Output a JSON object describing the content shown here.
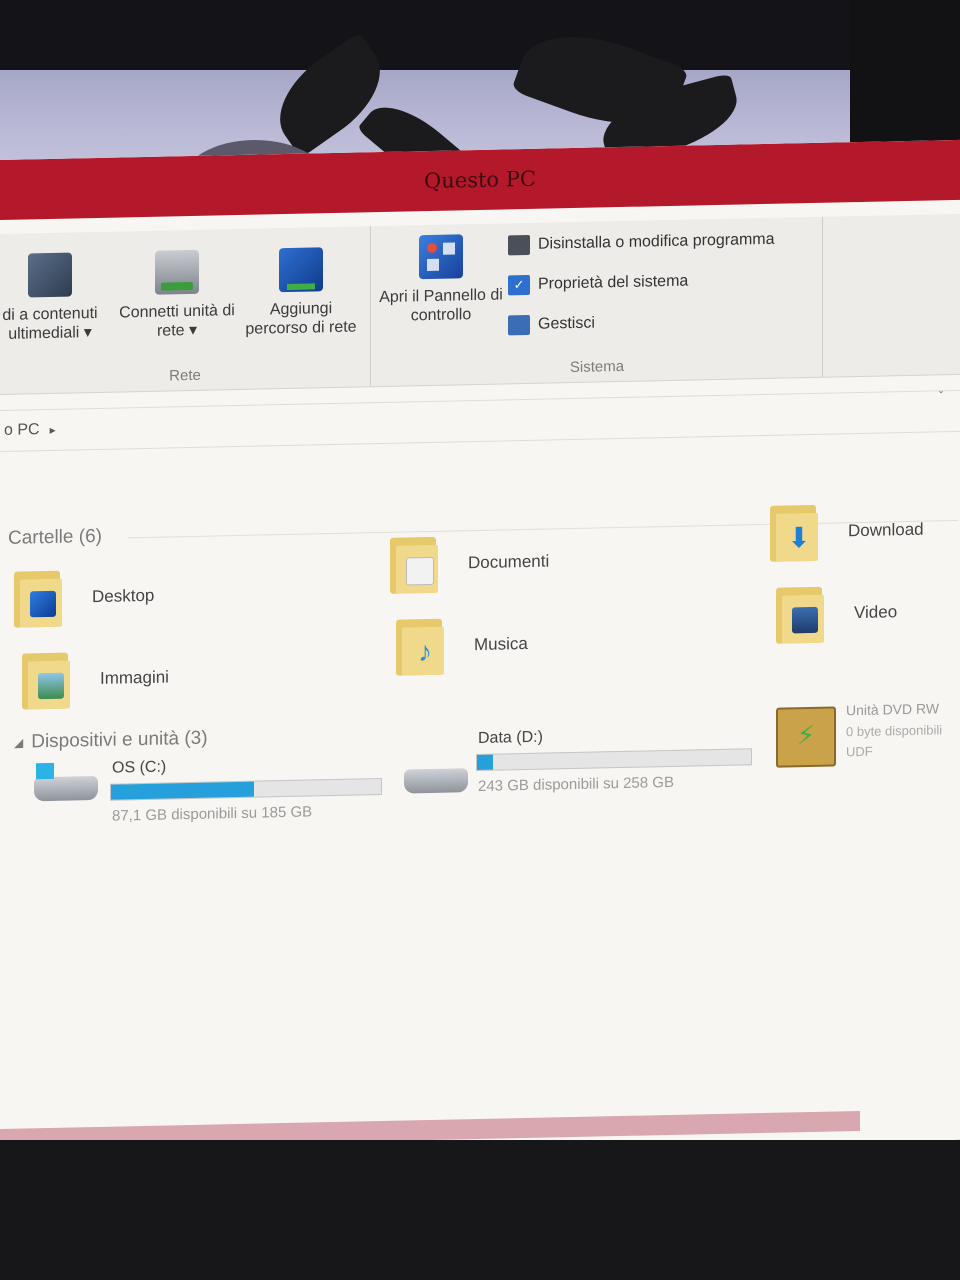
{
  "window": {
    "title": "Questo PC"
  },
  "ribbon": {
    "rete": {
      "label": "Rete",
      "buttons": [
        {
          "label": "di a contenuti ultimediali",
          "dropdown": true,
          "icon": "media-server-icon"
        },
        {
          "label": "Connetti unità di rete",
          "dropdown": true,
          "icon": "network-drive-icon"
        },
        {
          "label": "Aggiungi percorso di rete",
          "dropdown": false,
          "icon": "network-location-icon"
        }
      ]
    },
    "sistema": {
      "label": "Sistema",
      "big_button": {
        "label": "Apri il Pannello di controllo",
        "icon": "control-panel-icon"
      },
      "commands": [
        {
          "label": "Disinstalla o modifica programma",
          "icon": "uninstall-icon"
        },
        {
          "label": "Proprietà del sistema",
          "icon": "system-properties-icon"
        },
        {
          "label": "Gestisci",
          "icon": "manage-icon"
        }
      ]
    }
  },
  "address": {
    "path": "o PC",
    "separator": "▸"
  },
  "folders": {
    "header": "Cartelle (6)",
    "items": [
      {
        "label": "Desktop",
        "icon": "desktop-folder-icon"
      },
      {
        "label": "Documenti",
        "icon": "documents-folder-icon"
      },
      {
        "label": "Download",
        "icon": "downloads-folder-icon"
      },
      {
        "label": "Immagini",
        "icon": "pictures-folder-icon"
      },
      {
        "label": "Musica",
        "icon": "music-folder-icon"
      },
      {
        "label": "Video",
        "icon": "videos-folder-icon"
      }
    ]
  },
  "devices": {
    "header": "Dispositivi e unità (3)",
    "items": [
      {
        "name": "OS (C:)",
        "info": "87,1 GB disponibili su 185 GB",
        "used_fraction": 0.53,
        "icon": "windows-drive-icon"
      },
      {
        "name": "Data (D:)",
        "info": "243 GB disponibili su 258 GB",
        "used_fraction": 0.06,
        "icon": "hard-drive-icon"
      },
      {
        "name": "Unità DVD RW",
        "info": "0 byte disponibili",
        "fs": "UDF",
        "icon": "dvd-drive-icon"
      }
    ]
  },
  "colors": {
    "titlebar": "#b3182b",
    "drive_bar": "#26a0da",
    "folder": "#e6c96b"
  }
}
